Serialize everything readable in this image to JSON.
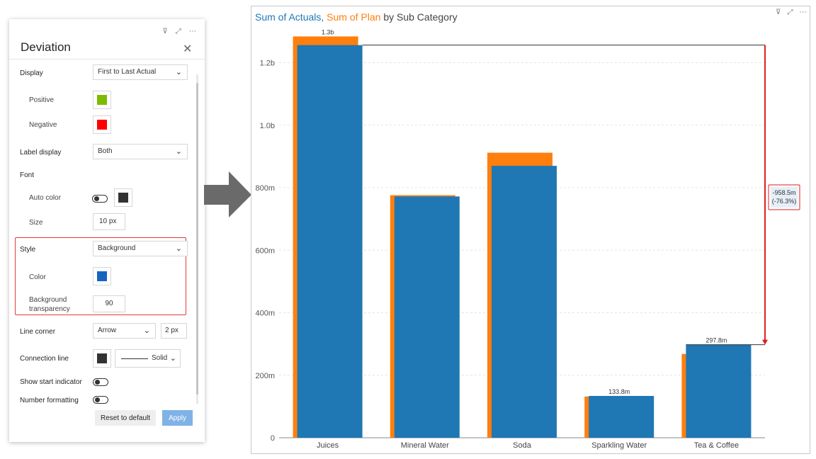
{
  "panel": {
    "title": "Deviation",
    "display": {
      "label": "Display",
      "value": "First to Last Actual"
    },
    "positive": {
      "label": "Positive",
      "color": "#7cbb00"
    },
    "negative": {
      "label": "Negative",
      "color": "#ff0000"
    },
    "label_display": {
      "label": "Label display",
      "value": "Both"
    },
    "font": {
      "label": "Font"
    },
    "auto_color": {
      "label": "Auto color",
      "color": "#333333"
    },
    "size": {
      "label": "Size",
      "value": "10 px"
    },
    "style": {
      "label": "Style",
      "value": "Background"
    },
    "color": {
      "label": "Color",
      "color": "#1565c0"
    },
    "bg_transparency": {
      "label_line1": "Background",
      "label_line2": "transparency",
      "value": "90"
    },
    "line_corner": {
      "label": "Line corner",
      "value": "Arrow",
      "size": "2 px"
    },
    "connection_line": {
      "label": "Connection line",
      "color": "#333333",
      "style": "Solid"
    },
    "show_start_indicator": {
      "label": "Show start indicator"
    },
    "number_formatting": {
      "label": "Number formatting"
    },
    "reset_label": "Reset to default",
    "apply_label": "Apply"
  },
  "chart": {
    "title_actuals": "Sum of Actuals",
    "title_sep": ", ",
    "title_plan": "Sum of Plan",
    "title_rest": " by Sub Category",
    "actual_color": "#1f77b4",
    "plan_color": "#ff7f0e",
    "deviation_color": "#e01e1e",
    "deviation_label_line1": "-958.5m",
    "deviation_label_line2": "(-76.3%)"
  },
  "chart_data": {
    "type": "bar",
    "categories": [
      "Juices",
      "Mineral Water",
      "Soda",
      "Sparkling Water",
      "Tea & Coffee"
    ],
    "series": [
      {
        "name": "Sum of Actuals",
        "values": [
          1256.3,
          772,
          870,
          133.8,
          297.8
        ]
      },
      {
        "name": "Sum of Plan",
        "values": [
          1284,
          776,
          912,
          132,
          268
        ]
      }
    ],
    "data_labels": [
      "1.3b",
      "",
      "",
      "133.8m",
      "297.8m"
    ],
    "yticks": [
      "0",
      "200m",
      "400m",
      "600m",
      "800m",
      "1.0b",
      "1.2b"
    ],
    "ylim": [
      0,
      1300
    ],
    "deviation": {
      "from": "Juices",
      "to": "Tea & Coffee",
      "value": "-958.5m",
      "percent": "(-76.3%)"
    }
  }
}
